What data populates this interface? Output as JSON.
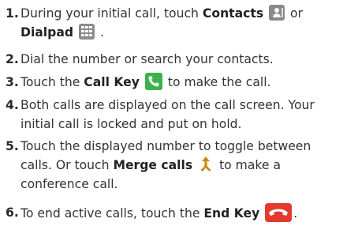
{
  "steps": [
    {
      "number": "1.",
      "t1": "During your initial call, touch ",
      "b1": "Contacts",
      "t2": " or",
      "b2": "Dialpad",
      "t3": " ."
    },
    {
      "number": "2.",
      "t1": "Dial the number or search your contacts."
    },
    {
      "number": "3.",
      "t1": "Touch the ",
      "b1": "Call Key",
      "t2": " to make the call."
    },
    {
      "number": "4.",
      "line1": "Both calls are displayed on the call screen. Your",
      "line2": "initial call is locked and put on hold."
    },
    {
      "number": "5.",
      "line1": "Touch the displayed number to toggle between",
      "t1": "calls. Or touch ",
      "b1": "Merge calls",
      "t2": " to make a",
      "line3": "conference call."
    },
    {
      "number": "6.",
      "t1": "To end active calls, touch the ",
      "b1": "End Key",
      "t2": "."
    }
  ],
  "icons": {
    "contacts": "contacts-icon",
    "dialpad": "dialpad-icon",
    "call_key": "call-key-icon",
    "merge_calls": "merge-calls-icon",
    "end_key": "end-key-icon"
  },
  "colors": {
    "text": "#333333",
    "icon_gray": "#8a8a8a",
    "call_green": "#3bb34a",
    "end_red": "#e23b2e"
  }
}
